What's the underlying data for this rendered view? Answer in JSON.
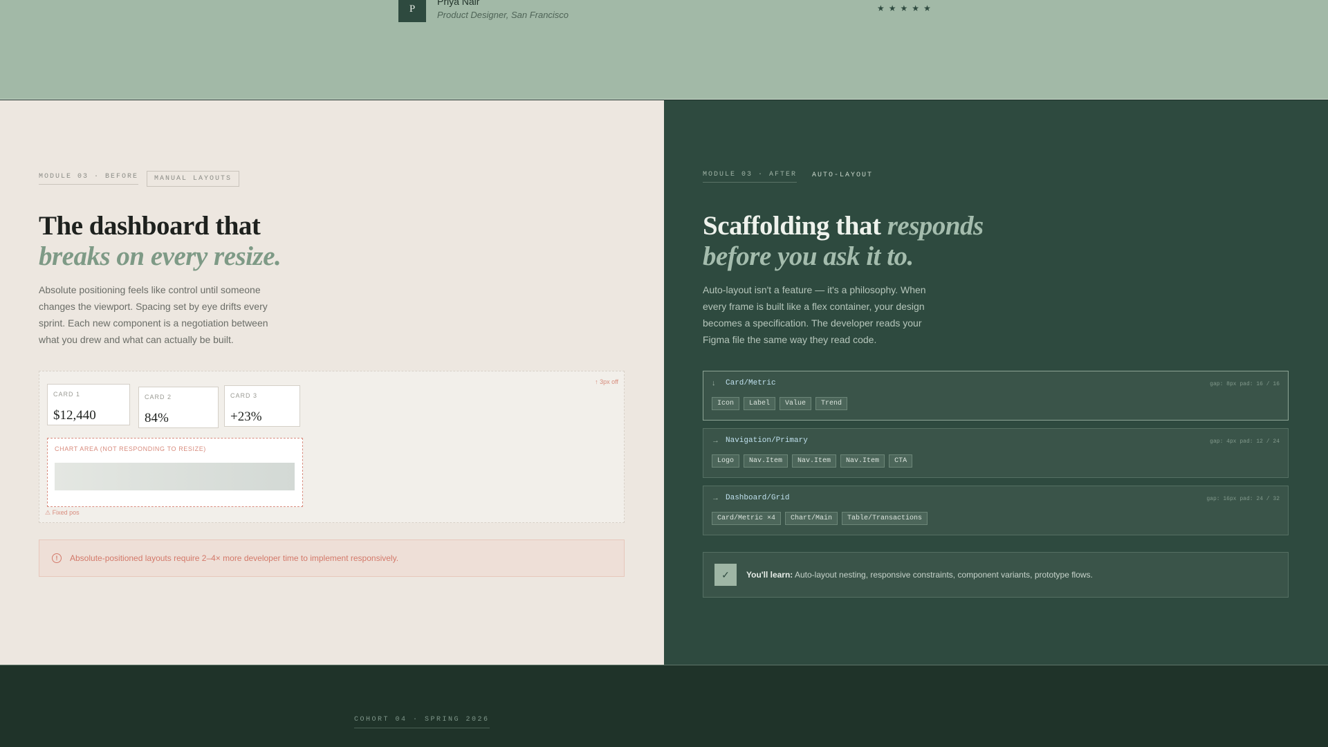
{
  "testimonial": {
    "avatar_initial": "P",
    "name": "Priya Nair",
    "role": "Product Designer, San Francisco",
    "stars": [
      "★",
      "★",
      "★",
      "★",
      "★"
    ]
  },
  "before": {
    "module_tag": "MODULE 03 · BEFORE",
    "badge": "MANUAL LAYOUTS",
    "headline_1": "The dashboard that",
    "headline_2": "breaks on every resize.",
    "paragraph": "Absolute positioning feels like control until someone changes the viewport. Spacing set by eye drifts every sprint. Each new component is a negotiation between what you drew and what can actually be built.",
    "mockup": {
      "offset_label": "↑ 3px off",
      "cards": [
        {
          "label": "CARD 1",
          "value": "$12,440"
        },
        {
          "label": "CARD 2",
          "value": "84%"
        },
        {
          "label": "CARD 3",
          "value": "+23%"
        }
      ],
      "chart_label": "CHART AREA (NOT RESPONDING TO RESIZE)",
      "fixed_label": "⚠ Fixed pos"
    },
    "alert": {
      "icon": "!",
      "text": "Absolute-positioned layouts require 2–4× more developer time to implement responsively."
    }
  },
  "after": {
    "module_tag": "MODULE 03 · AFTER",
    "badge": "AUTO-LAYOUT",
    "headline_1": "Scaffolding that ",
    "headline_1_italic": "responds",
    "headline_2": "before you ask it to.",
    "paragraph": "Auto-layout isn't a feature — it's a philosophy. When every frame is built like a flex container, your design becomes a specification. The developer reads your Figma file the same way they read code.",
    "components": [
      {
        "arrow": "↓",
        "name": "Card/Metric",
        "meta": "gap: 8px  pad: 16 / 16",
        "chips": [
          "Icon",
          "Label",
          "Value",
          "Trend"
        ]
      },
      {
        "arrow": "→",
        "name": "Navigation/Primary",
        "meta": "gap: 4px  pad: 12 / 24",
        "chips": [
          "Logo",
          "Nav.Item",
          "Nav.Item",
          "Nav.Item",
          "CTA"
        ]
      },
      {
        "arrow": "→",
        "name": "Dashboard/Grid",
        "meta": "gap: 16px  pad: 24 / 32",
        "chips": [
          "Card/Metric ×4",
          "Chart/Main",
          "Table/Transactions"
        ]
      }
    ],
    "learn": {
      "check": "✓",
      "label": "You'll learn:",
      "text": " Auto-layout nesting, responsive constraints, component variants, prototype flows."
    }
  },
  "footer": {
    "cohort": "COHORT 04 · SPRING 2026"
  }
}
